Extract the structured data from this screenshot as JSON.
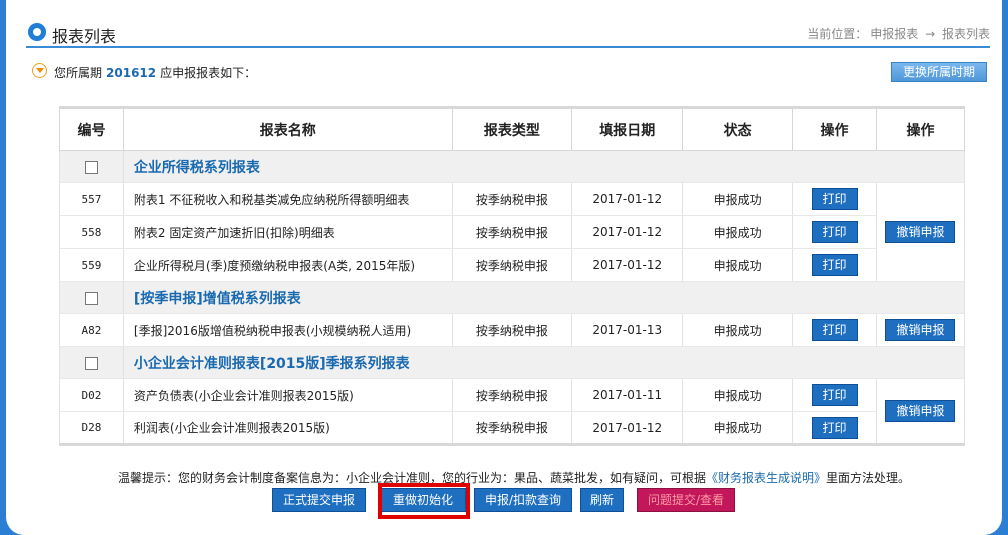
{
  "header": {
    "title": "报表列表",
    "breadcrumb_prefix": "当前位置：",
    "breadcrumb_1": "申报报表",
    "breadcrumb_arrow": "→",
    "breadcrumb_2": "报表列表"
  },
  "period": {
    "prefix": "您所属期",
    "value": "201612",
    "suffix": "应申报报表如下：",
    "change_button": "更换所属时期"
  },
  "table": {
    "columns": [
      "编号",
      "报表名称",
      "报表类型",
      "填报日期",
      "状态",
      "操作",
      "操作"
    ],
    "groups": [
      {
        "title": "企业所得税系列报表",
        "rows": [
          {
            "code": "557",
            "name": "附表1 不征税收入和税基类减免应纳税所得额明细表",
            "type": "按季纳税申报",
            "date": "2017-01-12",
            "status": "申报成功",
            "print": "打印"
          },
          {
            "code": "558",
            "name": "附表2 固定资产加速折旧(扣除)明细表",
            "type": "按季纳税申报",
            "date": "2017-01-12",
            "status": "申报成功",
            "print": "打印"
          },
          {
            "code": "559",
            "name": "企业所得税月(季)度预缴纳税申报表(A类, 2015年版)",
            "type": "按季纳税申报",
            "date": "2017-01-12",
            "status": "申报成功",
            "print": "打印"
          }
        ],
        "revoke": "撤销申报"
      },
      {
        "title": "[按季申报]增值税系列报表",
        "rows": [
          {
            "code": "A82",
            "name": "[季报]2016版增值税纳税申报表(小规模纳税人适用)",
            "type": "按季纳税申报",
            "date": "2017-01-13",
            "status": "申报成功",
            "print": "打印"
          }
        ],
        "revoke": "撤销申报"
      },
      {
        "title": "小企业会计准则报表[2015版]季报系列报表",
        "rows": [
          {
            "code": "D02",
            "name": "资产负债表(小企业会计准则报表2015版)",
            "type": "按季纳税申报",
            "date": "2017-01-11",
            "status": "申报成功",
            "print": "打印"
          },
          {
            "code": "D28",
            "name": "利润表(小企业会计准则报表2015版)",
            "type": "按季纳税申报",
            "date": "2017-01-12",
            "status": "申报成功",
            "print": "打印"
          }
        ],
        "revoke": "撤销申报"
      }
    ]
  },
  "tip": {
    "text": "温馨提示：您的财务会计制度备案信息为：小企业会计准则，您的行业为：果品、蔬菜批发，如有疑问，可根据",
    "link": "《财务报表生成说明》",
    "suffix": "里面方法处理。"
  },
  "actions": {
    "submit": "正式提交申报",
    "reinit": "重做初始化",
    "query": "申报/扣款查询",
    "refresh": "刷新",
    "issue": "问题提交/查看"
  },
  "colors": {
    "accent": "#1f6fc1",
    "highlight": "#e00000",
    "background": "#2a7fd4"
  }
}
